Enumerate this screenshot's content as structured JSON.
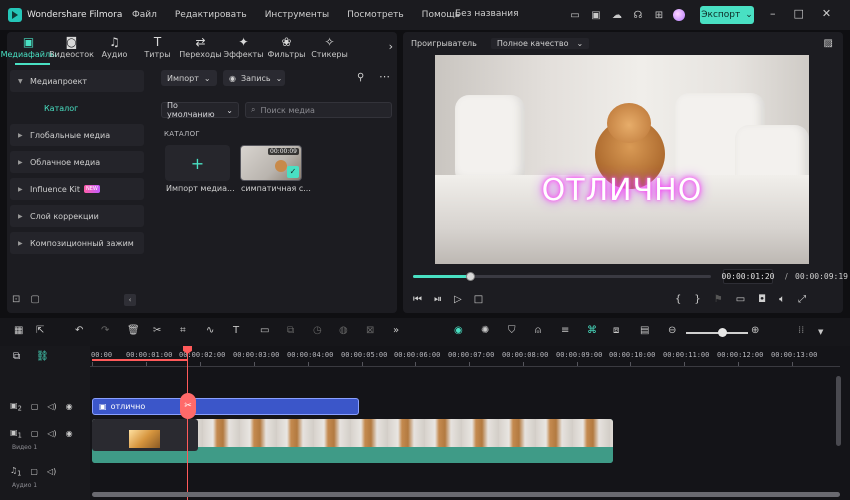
{
  "titlebar": {
    "app_name": "Wondershare Filmora",
    "menu": [
      "Файл",
      "Редактировать",
      "Инструменты",
      "Посмотреть",
      "Помощь"
    ],
    "project_title": "Без названия",
    "export_label": "Экспорт"
  },
  "media_tabs": [
    {
      "label": "Медиафайлы",
      "icon": "media-icon"
    },
    {
      "label": "Видеосток",
      "icon": "stock-icon"
    },
    {
      "label": "Аудио",
      "icon": "audio-icon"
    },
    {
      "label": "Титры",
      "icon": "titles-icon"
    },
    {
      "label": "Переходы",
      "icon": "transitions-icon"
    },
    {
      "label": "Эффекты",
      "icon": "effects-icon"
    },
    {
      "label": "Фильтры",
      "icon": "filters-icon"
    },
    {
      "label": "Стикеры",
      "icon": "stickers-icon"
    }
  ],
  "sidebar": {
    "items": [
      {
        "label": "Медиапроект",
        "expanded": true
      },
      {
        "label": "Каталог",
        "sub": true
      },
      {
        "label": "Глобальные медиа"
      },
      {
        "label": "Облачное медиа"
      },
      {
        "label": "Influence Kit",
        "badge": "NEW"
      },
      {
        "label": "Слой коррекции"
      },
      {
        "label": "Композиционный зажим"
      }
    ]
  },
  "media": {
    "import_label": "Импорт",
    "record_label": "Запись",
    "sort_label": "По умолчанию",
    "search_placeholder": "Поиск медиа",
    "section": "КАТАЛОГ",
    "import_card_label": "Импорт медиа...",
    "clip_label": "симпатичная с...",
    "clip_duration": "00:00:09"
  },
  "player": {
    "tab_label": "Проигрыватель",
    "quality_label": "Полное качество",
    "overlay_text": "ОТЛИЧНО",
    "current_time": "00:00:01:20",
    "separator": "/",
    "total_time": "00:00:09:19",
    "progress": 0.19
  },
  "timeline": {
    "ruler_labels": [
      "00:00",
      "00:00:01:00",
      "00:00:02:00",
      "00:00:03:00",
      "00:00:04:00",
      "00:00:05:00",
      "00:00:06:00",
      "00:00:07:00",
      "00:00:08:00",
      "00:00:09:00",
      "00:00:10:00",
      "00:00:11:00",
      "00:00:12:00",
      "00:00:13:00"
    ],
    "title_clip_label": "отлично",
    "tracks": [
      {
        "number": "2",
        "name": ""
      },
      {
        "number": "1",
        "name": "Видео 1"
      },
      {
        "number": "1",
        "name": "Аудио 1"
      }
    ]
  },
  "colors": {
    "accent": "#49e0c3",
    "playhead": "#ff5a5a",
    "title_clip": "#3b56c9",
    "video_clip": "#3d8f7f"
  }
}
